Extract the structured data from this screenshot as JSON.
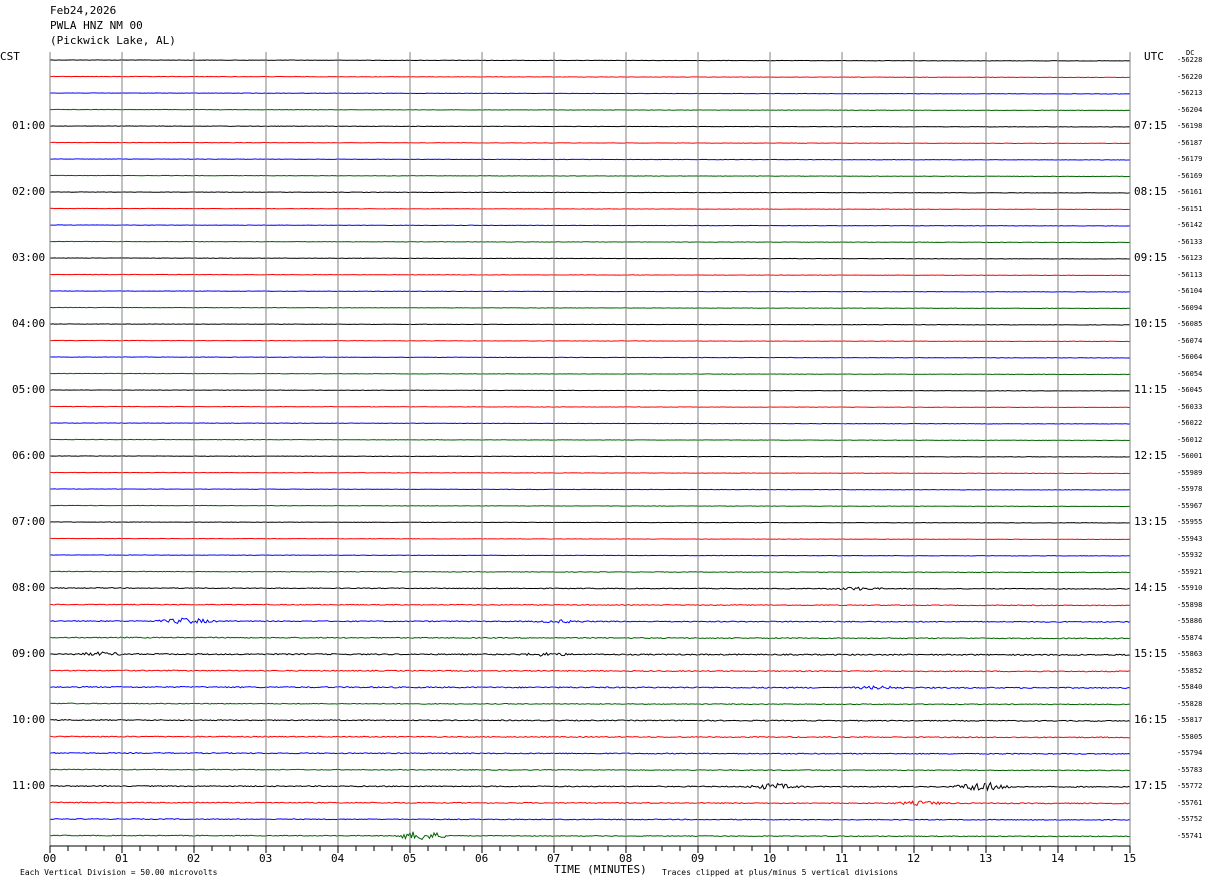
{
  "header": {
    "date": "Feb24,2026",
    "station": "PWLA HNZ NM 00",
    "location": "(Pickwick Lake, AL)"
  },
  "axis": {
    "left_tz": "CST",
    "right_tz": "UTC",
    "dc_label": "DC",
    "xlabel": "TIME (MINUTES)",
    "scale_note": "Each Vertical Division =   50.00 microvolts",
    "clip_note": "Traces clipped at plus/minus 5 vertical divisions"
  },
  "chart_data": {
    "type": "line",
    "title": "",
    "xlabel": "TIME (MINUTES)",
    "xlim": [
      0,
      15
    ],
    "x_ticks": [
      "00",
      "01",
      "02",
      "03",
      "04",
      "05",
      "06",
      "07",
      "08",
      "09",
      "10",
      "11",
      "12",
      "13",
      "14",
      "15"
    ],
    "trace_colors": [
      "#000000",
      "#ff0000",
      "#0000ff",
      "#006400"
    ],
    "trace_count": 48,
    "left_hour_labels": [
      "01:00",
      "02:00",
      "03:00",
      "04:00",
      "05:00",
      "06:00",
      "07:00",
      "08:00",
      "09:00",
      "10:00",
      "11:00"
    ],
    "right_hour_labels": [
      "07:15",
      "08:15",
      "09:15",
      "10:15",
      "11:15",
      "12:15",
      "13:15",
      "14:15",
      "15:15",
      "16:15",
      "17:15"
    ],
    "right_dc_values": [
      "-56228",
      "-56220",
      "-56213",
      "-56204",
      "-56198",
      "-56187",
      "-56179",
      "-56169",
      "-56161",
      "-56151",
      "-56142",
      "-56133",
      "-56123",
      "-56113",
      "-56104",
      "-56094",
      "-56085",
      "-56074",
      "-56064",
      "-56054",
      "-56045",
      "-56033",
      "-56022",
      "-56012",
      "-56001",
      "-55989",
      "-55978",
      "-55967",
      "-55955",
      "-55943",
      "-55932",
      "-55921",
      "-55910",
      "-55898",
      "-55886",
      "-55874",
      "-55863",
      "-55852",
      "-55840",
      "-55828",
      "-55817",
      "-55805",
      "-55794",
      "-55783",
      "-55772",
      "-55761",
      "-55752",
      "-55741"
    ],
    "noise_amplitude": [
      0.2,
      0.2,
      0.2,
      0.2,
      0.2,
      0.2,
      0.2,
      0.2,
      0.2,
      0.2,
      0.2,
      0.2,
      0.2,
      0.2,
      0.2,
      0.2,
      0.2,
      0.2,
      0.2,
      0.2,
      0.2,
      0.2,
      0.2,
      0.2,
      0.2,
      0.2,
      0.2,
      0.2,
      0.2,
      0.2,
      0.2,
      0.3,
      0.4,
      0.4,
      0.5,
      0.5,
      0.6,
      0.5,
      0.6,
      0.4,
      0.5,
      0.5,
      0.5,
      0.4,
      0.5,
      0.5,
      0.4,
      0.4
    ],
    "events": [
      {
        "trace": 32,
        "minute": 11.2,
        "amplitude": 1.5
      },
      {
        "trace": 34,
        "minute": 1.9,
        "amplitude": 3
      },
      {
        "trace": 34,
        "minute": 7.1,
        "amplitude": 1.2
      },
      {
        "trace": 36,
        "minute": 0.7,
        "amplitude": 1.5
      },
      {
        "trace": 36,
        "minute": 6.9,
        "amplitude": 1.5
      },
      {
        "trace": 38,
        "minute": 11.5,
        "amplitude": 1.2
      },
      {
        "trace": 44,
        "minute": 10.05,
        "amplitude": 3
      },
      {
        "trace": 44,
        "minute": 12.95,
        "amplitude": 5
      },
      {
        "trace": 45,
        "minute": 12.1,
        "amplitude": 2
      },
      {
        "trace": 47,
        "minute": 5.15,
        "amplitude": 5
      }
    ]
  }
}
